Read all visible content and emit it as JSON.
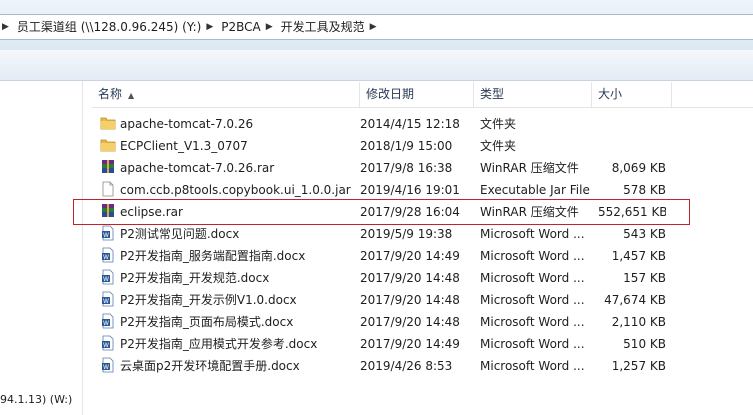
{
  "address": {
    "crumbs": [
      "员工渠道组 (\\\\128.0.96.245) (Y:)",
      "P2BCA",
      "开发工具及规范"
    ]
  },
  "nav": {
    "drive_label": "94.1.13) (W:)"
  },
  "columns": {
    "name": "名称",
    "date": "修改日期",
    "type": "类型",
    "size": "大小"
  },
  "files": [
    {
      "name": "apache-tomcat-7.0.26",
      "date": "2014/4/15 12:18",
      "type": "文件夹",
      "size": "",
      "icon": "folder-icon"
    },
    {
      "name": "ECPClient_V1.3_0707",
      "date": "2018/1/9 15:00",
      "type": "文件夹",
      "size": "",
      "icon": "folder-icon"
    },
    {
      "name": "apache-tomcat-7.0.26.rar",
      "date": "2017/9/8 16:38",
      "type": "WinRAR 压缩文件",
      "size": "8,069 KB",
      "icon": "winrar-icon"
    },
    {
      "name": "com.ccb.p8tools.copybook.ui_1.0.0.jar",
      "date": "2019/4/16 19:01",
      "type": "Executable Jar File",
      "size": "578 KB",
      "icon": "jar-icon"
    },
    {
      "name": "eclipse.rar",
      "date": "2017/9/28 16:04",
      "type": "WinRAR 压缩文件",
      "size": "552,651 KB",
      "icon": "winrar-icon"
    },
    {
      "name": "P2测试常见问题.docx",
      "date": "2019/5/9 19:38",
      "type": "Microsoft Word ...",
      "size": "543 KB",
      "icon": "word-icon"
    },
    {
      "name": "P2开发指南_服务端配置指南.docx",
      "date": "2017/9/20 14:49",
      "type": "Microsoft Word ...",
      "size": "1,457 KB",
      "icon": "word-icon"
    },
    {
      "name": "P2开发指南_开发规范.docx",
      "date": "2017/9/20 14:48",
      "type": "Microsoft Word ...",
      "size": "157 KB",
      "icon": "word-icon"
    },
    {
      "name": "P2开发指南_开发示例V1.0.docx",
      "date": "2017/9/20 14:48",
      "type": "Microsoft Word ...",
      "size": "47,674 KB",
      "icon": "word-icon"
    },
    {
      "name": "P2开发指南_页面布局模式.docx",
      "date": "2017/9/20 14:48",
      "type": "Microsoft Word ...",
      "size": "2,110 KB",
      "icon": "word-icon"
    },
    {
      "name": "P2开发指南_应用模式开发参考.docx",
      "date": "2017/9/20 14:49",
      "type": "Microsoft Word ...",
      "size": "510 KB",
      "icon": "word-icon"
    },
    {
      "name": "云桌面p2开发环境配置手册.docx",
      "date": "2019/4/26 8:53",
      "type": "Microsoft Word ...",
      "size": "1,257 KB",
      "icon": "word-icon"
    }
  ],
  "colors": {
    "highlight": "#c8202a",
    "folder": "#e8b84a",
    "word": "#2b5797"
  }
}
